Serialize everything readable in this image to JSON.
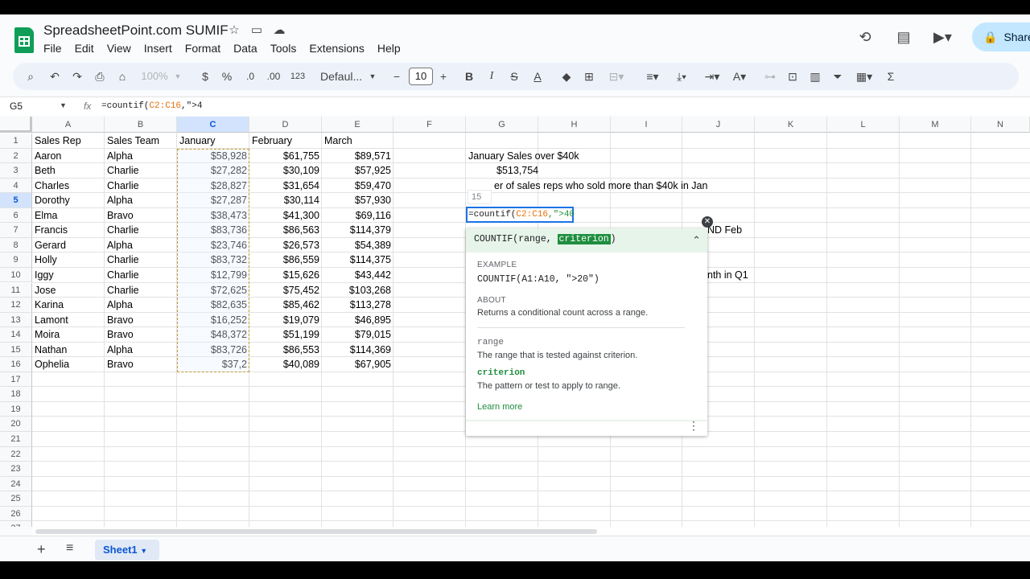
{
  "app": {
    "title": "SpreadsheetPoint.com SUMIF",
    "menu": [
      "File",
      "Edit",
      "View",
      "Insert",
      "Format",
      "Data",
      "Tools",
      "Extensions",
      "Help"
    ],
    "share_label": "Share"
  },
  "toolbar": {
    "zoom": "100%",
    "currency": "$",
    "percent": "%",
    "dec_decrease": ".0",
    "dec_increase": ".00",
    "number_format": "123",
    "font": "Defaul...",
    "font_size": "10"
  },
  "formula_bar": {
    "name_box": "G5",
    "fx": "fx",
    "formula_prefix": "=countif(",
    "formula_range": "C2:C16",
    "formula_suffix": ",\">4"
  },
  "columns": [
    "A",
    "B",
    "C",
    "D",
    "E",
    "F",
    "G",
    "H",
    "I",
    "J",
    "K",
    "L",
    "M",
    "N"
  ],
  "rows": [
    "1",
    "2",
    "3",
    "4",
    "5",
    "6",
    "7",
    "8",
    "9",
    "10",
    "11",
    "12",
    "13",
    "14",
    "15",
    "16",
    "17",
    "18",
    "19",
    "20",
    "21",
    "22",
    "23",
    "24",
    "25",
    "26",
    "27"
  ],
  "headers": {
    "a": "Sales Rep",
    "b": "Sales Team",
    "c": "January",
    "d": "February",
    "e": "March"
  },
  "table": [
    {
      "rep": "Aaron",
      "team": "Alpha",
      "jan": "$58,928",
      "feb": "$61,755",
      "mar": "$89,571"
    },
    {
      "rep": "Beth",
      "team": "Charlie",
      "jan": "$27,282",
      "feb": "$30,109",
      "mar": "$57,925"
    },
    {
      "rep": "Charles",
      "team": "Charlie",
      "jan": "$28,827",
      "feb": "$31,654",
      "mar": "$59,470"
    },
    {
      "rep": "Dorothy",
      "team": "Alpha",
      "jan": "$27,287",
      "feb": "$30,114",
      "mar": "$57,930"
    },
    {
      "rep": "Elma",
      "team": "Bravo",
      "jan": "$38,473",
      "feb": "$41,300",
      "mar": "$69,116"
    },
    {
      "rep": "Francis",
      "team": "Charlie",
      "jan": "$83,736",
      "feb": "$86,563",
      "mar": "$114,379"
    },
    {
      "rep": "Gerard",
      "team": "Alpha",
      "jan": "$23,746",
      "feb": "$26,573",
      "mar": "$54,389"
    },
    {
      "rep": "Holly",
      "team": "Charlie",
      "jan": "$83,732",
      "feb": "$86,559",
      "mar": "$114,375"
    },
    {
      "rep": "Iggy",
      "team": "Charlie",
      "jan": "$12,799",
      "feb": "$15,626",
      "mar": "$43,442"
    },
    {
      "rep": "Jose",
      "team": "Charlie",
      "jan": "$72,625",
      "feb": "$75,452",
      "mar": "$103,268"
    },
    {
      "rep": "Karina",
      "team": "Alpha",
      "jan": "$82,635",
      "feb": "$85,462",
      "mar": "$113,278"
    },
    {
      "rep": "Lamont",
      "team": "Bravo",
      "jan": "$16,252",
      "feb": "$19,079",
      "mar": "$46,895"
    },
    {
      "rep": "Moira",
      "team": "Bravo",
      "jan": "$48,372",
      "feb": "$51,199",
      "mar": "$79,015"
    },
    {
      "rep": "Nathan",
      "team": "Alpha",
      "jan": "$83,726",
      "feb": "$86,553",
      "mar": "$114,369"
    },
    {
      "rep": "Ophelia",
      "team": "Bravo",
      "jan": "$37,2",
      "feb": "$40,089",
      "mar": "$67,905"
    }
  ],
  "side_notes": {
    "g2": "January Sales over $40k",
    "g3": "$513,754",
    "g4": "er of sales reps who sold more than $40k in Jan",
    "j7": "ND Feb",
    "j10": "nth in Q1"
  },
  "editor": {
    "preview_count": "15",
    "text_prefix": "=countif(",
    "text_range": "C2:C16",
    "text_suffix": ",\">40"
  },
  "help_popup": {
    "signature_name": "COUNTIF(range, ",
    "signature_arg": "criterion",
    "signature_end": ")",
    "example_label": "EXAMPLE",
    "example": "COUNTIF(A1:A10, \">20\")",
    "about_label": "ABOUT",
    "about": "Returns a conditional count across a range.",
    "arg1_name": "range",
    "arg1_desc": "The range that is tested against criterion.",
    "arg2_name": "criterion",
    "arg2_desc": "The pattern or test to apply to range.",
    "learn_more": "Learn more"
  },
  "sheet_tab": "Sheet1"
}
